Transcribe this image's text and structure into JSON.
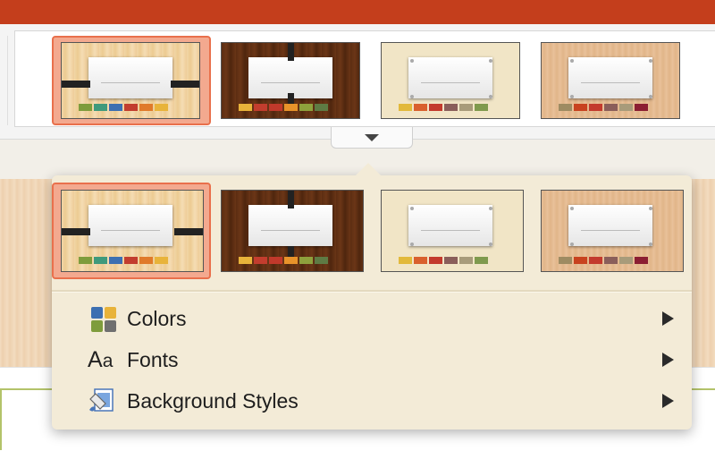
{
  "menu": {
    "items": [
      {
        "label": "Colors",
        "icon": "colors-icon"
      },
      {
        "label": "Fonts",
        "icon": "fonts-icon"
      },
      {
        "label": "Background Styles",
        "icon": "background-styles-icon"
      }
    ]
  },
  "fonts_icon": {
    "big": "A",
    "small": "a"
  },
  "themes": [
    {
      "variant": "wood-light",
      "swatches": [
        "#7e9c3c",
        "#3f9a7c",
        "#3c6fb1",
        "#c23d2e",
        "#e07a2a",
        "#e8b33a"
      ]
    },
    {
      "variant": "wood-dark",
      "swatches": [
        "#e8b33a",
        "#c23d2e",
        "#c0392b",
        "#e8932a",
        "#8ea13c",
        "#5e7b44"
      ]
    },
    {
      "variant": "paper",
      "swatches": [
        "#e2b93b",
        "#d9602d",
        "#c33a2d",
        "#8a5e5a",
        "#a89b7a",
        "#7f9a4d"
      ]
    },
    {
      "variant": "paper-warm",
      "swatches": [
        "#9e8b62",
        "#c8421f",
        "#c33a2d",
        "#8a5e5a",
        "#a89b7a",
        "#8b1e32"
      ]
    }
  ],
  "colors": {
    "accent": "#c43e1c",
    "selection": "#e9704c",
    "menu_bg": "#f3ebd7"
  }
}
